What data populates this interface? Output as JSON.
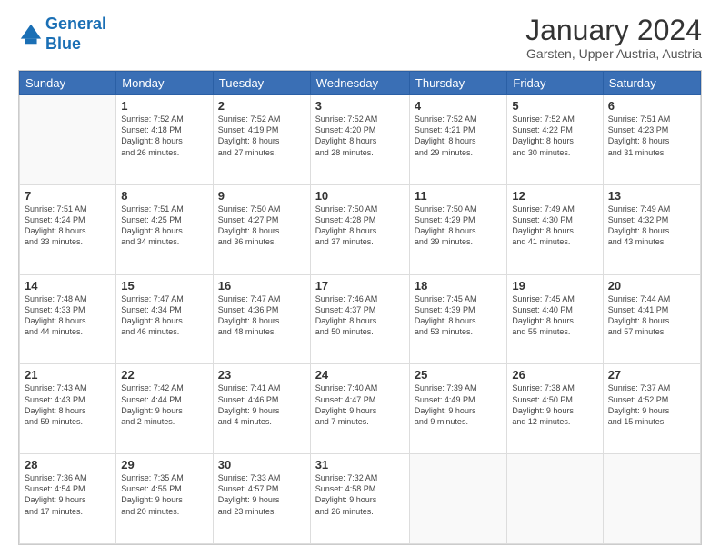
{
  "logo": {
    "line1": "General",
    "line2": "Blue"
  },
  "title": "January 2024",
  "subtitle": "Garsten, Upper Austria, Austria",
  "days_of_week": [
    "Sunday",
    "Monday",
    "Tuesday",
    "Wednesday",
    "Thursday",
    "Friday",
    "Saturday"
  ],
  "weeks": [
    [
      {
        "day": "",
        "info": ""
      },
      {
        "day": "1",
        "info": "Sunrise: 7:52 AM\nSunset: 4:18 PM\nDaylight: 8 hours\nand 26 minutes."
      },
      {
        "day": "2",
        "info": "Sunrise: 7:52 AM\nSunset: 4:19 PM\nDaylight: 8 hours\nand 27 minutes."
      },
      {
        "day": "3",
        "info": "Sunrise: 7:52 AM\nSunset: 4:20 PM\nDaylight: 8 hours\nand 28 minutes."
      },
      {
        "day": "4",
        "info": "Sunrise: 7:52 AM\nSunset: 4:21 PM\nDaylight: 8 hours\nand 29 minutes."
      },
      {
        "day": "5",
        "info": "Sunrise: 7:52 AM\nSunset: 4:22 PM\nDaylight: 8 hours\nand 30 minutes."
      },
      {
        "day": "6",
        "info": "Sunrise: 7:51 AM\nSunset: 4:23 PM\nDaylight: 8 hours\nand 31 minutes."
      }
    ],
    [
      {
        "day": "7",
        "info": "Sunrise: 7:51 AM\nSunset: 4:24 PM\nDaylight: 8 hours\nand 33 minutes."
      },
      {
        "day": "8",
        "info": "Sunrise: 7:51 AM\nSunset: 4:25 PM\nDaylight: 8 hours\nand 34 minutes."
      },
      {
        "day": "9",
        "info": "Sunrise: 7:50 AM\nSunset: 4:27 PM\nDaylight: 8 hours\nand 36 minutes."
      },
      {
        "day": "10",
        "info": "Sunrise: 7:50 AM\nSunset: 4:28 PM\nDaylight: 8 hours\nand 37 minutes."
      },
      {
        "day": "11",
        "info": "Sunrise: 7:50 AM\nSunset: 4:29 PM\nDaylight: 8 hours\nand 39 minutes."
      },
      {
        "day": "12",
        "info": "Sunrise: 7:49 AM\nSunset: 4:30 PM\nDaylight: 8 hours\nand 41 minutes."
      },
      {
        "day": "13",
        "info": "Sunrise: 7:49 AM\nSunset: 4:32 PM\nDaylight: 8 hours\nand 43 minutes."
      }
    ],
    [
      {
        "day": "14",
        "info": "Sunrise: 7:48 AM\nSunset: 4:33 PM\nDaylight: 8 hours\nand 44 minutes."
      },
      {
        "day": "15",
        "info": "Sunrise: 7:47 AM\nSunset: 4:34 PM\nDaylight: 8 hours\nand 46 minutes."
      },
      {
        "day": "16",
        "info": "Sunrise: 7:47 AM\nSunset: 4:36 PM\nDaylight: 8 hours\nand 48 minutes."
      },
      {
        "day": "17",
        "info": "Sunrise: 7:46 AM\nSunset: 4:37 PM\nDaylight: 8 hours\nand 50 minutes."
      },
      {
        "day": "18",
        "info": "Sunrise: 7:45 AM\nSunset: 4:39 PM\nDaylight: 8 hours\nand 53 minutes."
      },
      {
        "day": "19",
        "info": "Sunrise: 7:45 AM\nSunset: 4:40 PM\nDaylight: 8 hours\nand 55 minutes."
      },
      {
        "day": "20",
        "info": "Sunrise: 7:44 AM\nSunset: 4:41 PM\nDaylight: 8 hours\nand 57 minutes."
      }
    ],
    [
      {
        "day": "21",
        "info": "Sunrise: 7:43 AM\nSunset: 4:43 PM\nDaylight: 8 hours\nand 59 minutes."
      },
      {
        "day": "22",
        "info": "Sunrise: 7:42 AM\nSunset: 4:44 PM\nDaylight: 9 hours\nand 2 minutes."
      },
      {
        "day": "23",
        "info": "Sunrise: 7:41 AM\nSunset: 4:46 PM\nDaylight: 9 hours\nand 4 minutes."
      },
      {
        "day": "24",
        "info": "Sunrise: 7:40 AM\nSunset: 4:47 PM\nDaylight: 9 hours\nand 7 minutes."
      },
      {
        "day": "25",
        "info": "Sunrise: 7:39 AM\nSunset: 4:49 PM\nDaylight: 9 hours\nand 9 minutes."
      },
      {
        "day": "26",
        "info": "Sunrise: 7:38 AM\nSunset: 4:50 PM\nDaylight: 9 hours\nand 12 minutes."
      },
      {
        "day": "27",
        "info": "Sunrise: 7:37 AM\nSunset: 4:52 PM\nDaylight: 9 hours\nand 15 minutes."
      }
    ],
    [
      {
        "day": "28",
        "info": "Sunrise: 7:36 AM\nSunset: 4:54 PM\nDaylight: 9 hours\nand 17 minutes."
      },
      {
        "day": "29",
        "info": "Sunrise: 7:35 AM\nSunset: 4:55 PM\nDaylight: 9 hours\nand 20 minutes."
      },
      {
        "day": "30",
        "info": "Sunrise: 7:33 AM\nSunset: 4:57 PM\nDaylight: 9 hours\nand 23 minutes."
      },
      {
        "day": "31",
        "info": "Sunrise: 7:32 AM\nSunset: 4:58 PM\nDaylight: 9 hours\nand 26 minutes."
      },
      {
        "day": "",
        "info": ""
      },
      {
        "day": "",
        "info": ""
      },
      {
        "day": "",
        "info": ""
      }
    ]
  ]
}
